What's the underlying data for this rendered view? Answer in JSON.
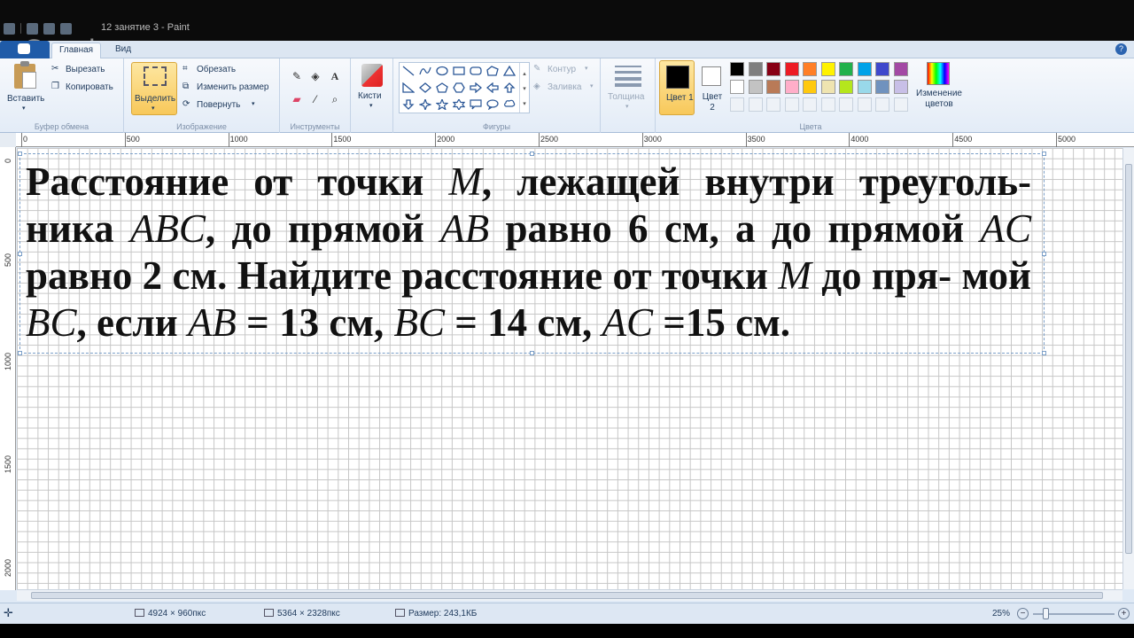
{
  "window": {
    "title": "12 занятие 3 - Paint"
  },
  "overlay": {
    "watermark": "Google+"
  },
  "tabs": {
    "home": "Главная",
    "view": "Вид"
  },
  "ribbon": {
    "clipboard": {
      "label": "Буфер обмена",
      "paste": "Вставить",
      "cut": "Вырезать",
      "copy": "Копировать"
    },
    "image": {
      "label": "Изображение",
      "select": "Выделить",
      "crop": "Обрезать",
      "resize": "Изменить размер",
      "rotate": "Повернуть"
    },
    "tools": {
      "label": "Инструменты"
    },
    "brushes": {
      "label": "Кисти"
    },
    "shapes": {
      "label": "Фигуры",
      "outline": "Контур",
      "fill": "Заливка"
    },
    "size": {
      "label": "Толщина"
    },
    "colors": {
      "label": "Цвета",
      "color1": "Цвет 1",
      "color2": "Цвет 2",
      "edit": "Изменение цветов",
      "palette_row1": [
        "#000000",
        "#7f7f7f",
        "#880015",
        "#ed1c24",
        "#ff7f27",
        "#fff200",
        "#22b14c",
        "#00a2e8",
        "#3f48cc",
        "#a349a4"
      ],
      "palette_row2": [
        "#ffffff",
        "#c3c3c3",
        "#b97a57",
        "#ffaec9",
        "#ffc90e",
        "#efe4b0",
        "#b5e61d",
        "#99d9ea",
        "#7092be",
        "#c8bfe7"
      ]
    }
  },
  "ruler": {
    "top": [
      "0",
      "500",
      "1000",
      "1500",
      "2000",
      "2500",
      "3000",
      "3500",
      "4000",
      "4500",
      "5000"
    ],
    "left": [
      "0",
      "500",
      "1000",
      "1500",
      "2000"
    ]
  },
  "canvas": {
    "line1_a": "Расстояние от точки ",
    "line1_m": "M",
    "line1_b": ", лежащей внутри треуголь-",
    "line2_a": "ника ",
    "line2_abc": "ABC",
    "line2_b": ", до прямой ",
    "line2_ab": "AB",
    "line2_c": " равно 6 см, а до прямой ",
    "line2_ac": "AC",
    "line3_a": "равно 2 см. Найдите расстояние от точки ",
    "line3_m": "M",
    "line3_b": " до пря-",
    "line4_a": "мой ",
    "line4_bc": "BC",
    "line4_b": ", если ",
    "line4_ab": "AB",
    "line4_c": " = 13 см, ",
    "line4_bc2": "BC",
    "line4_d": " = 14 см, ",
    "line4_ac": "AC",
    "line4_e": " =15 см."
  },
  "status": {
    "selection_size": "4924 × 960пкс",
    "image_size": "5364 × 2328пкс",
    "file_size": "Размер: 243,1КБ",
    "zoom": "25%"
  }
}
